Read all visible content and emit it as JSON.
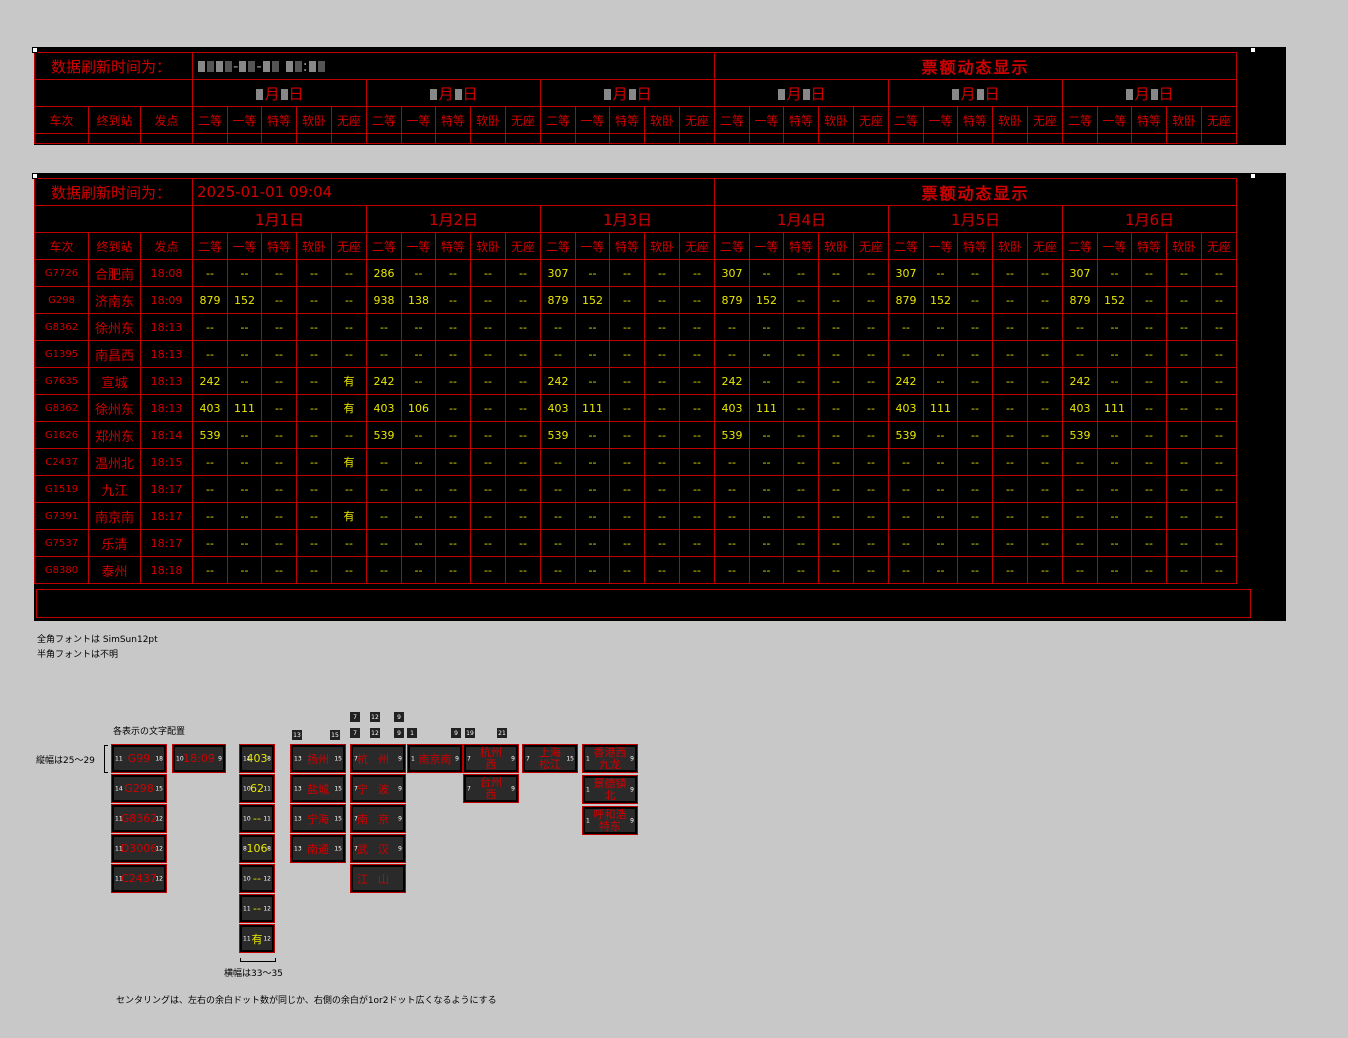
{
  "board_masked": {
    "label": "数据刷新时间为：",
    "title": "票额动态显示",
    "dates": [
      "月日",
      "月日",
      "月日",
      "月日",
      "月日",
      "月日"
    ]
  },
  "board": {
    "label": "数据刷新时间为：",
    "time": "2025-01-01 09:04",
    "title": "票额动态显示",
    "dates": [
      "1月1日",
      "1月2日",
      "1月3日",
      "1月4日",
      "1月5日",
      "1月6日"
    ],
    "col_train": "车次",
    "col_station": "终到站",
    "col_depart": "发点",
    "seat_types": [
      "二等",
      "一等",
      "特等",
      "软卧",
      "无座"
    ],
    "rows": [
      {
        "train": "G7726",
        "station": "合肥南",
        "time": "18:08",
        "cells": [
          "--",
          "--",
          "--",
          "--",
          "--",
          "286",
          "--",
          "--",
          "--",
          "--",
          "307",
          "--",
          "--",
          "--",
          "--",
          "307",
          "--",
          "--",
          "--",
          "--",
          "307",
          "--",
          "--",
          "--",
          "--",
          "307",
          "--",
          "--",
          "--",
          "--"
        ]
      },
      {
        "train": "G298",
        "station": "济南东",
        "time": "18:09",
        "cells": [
          "879",
          "152",
          "--",
          "--",
          "--",
          "938",
          "138",
          "--",
          "--",
          "--",
          "879",
          "152",
          "--",
          "--",
          "--",
          "879",
          "152",
          "--",
          "--",
          "--",
          "879",
          "152",
          "--",
          "--",
          "--",
          "879",
          "152",
          "--",
          "--",
          "--"
        ]
      },
      {
        "train": "G8362",
        "station": "徐州东",
        "time": "18:13",
        "cells": [
          "--",
          "--",
          "--",
          "--",
          "--",
          "--",
          "--",
          "--",
          "--",
          "--",
          "--",
          "--",
          "--",
          "--",
          "--",
          "--",
          "--",
          "--",
          "--",
          "--",
          "--",
          "--",
          "--",
          "--",
          "--",
          "--",
          "--",
          "--",
          "--",
          "--"
        ]
      },
      {
        "train": "G1395",
        "station": "南昌西",
        "time": "18:13",
        "cells": [
          "--",
          "--",
          "--",
          "--",
          "--",
          "--",
          "--",
          "--",
          "--",
          "--",
          "--",
          "--",
          "--",
          "--",
          "--",
          "--",
          "--",
          "--",
          "--",
          "--",
          "--",
          "--",
          "--",
          "--",
          "--",
          "--",
          "--",
          "--",
          "--",
          "--"
        ]
      },
      {
        "train": "G7635",
        "station": "宣城",
        "time": "18:13",
        "cells": [
          "242",
          "--",
          "--",
          "--",
          "有",
          "242",
          "--",
          "--",
          "--",
          "--",
          "242",
          "--",
          "--",
          "--",
          "--",
          "242",
          "--",
          "--",
          "--",
          "--",
          "242",
          "--",
          "--",
          "--",
          "--",
          "242",
          "--",
          "--",
          "--",
          "--"
        ]
      },
      {
        "train": "G8362",
        "station": "徐州东",
        "time": "18:13",
        "cells": [
          "403",
          "111",
          "--",
          "--",
          "有",
          "403",
          "106",
          "--",
          "--",
          "--",
          "403",
          "111",
          "--",
          "--",
          "--",
          "403",
          "111",
          "--",
          "--",
          "--",
          "403",
          "111",
          "--",
          "--",
          "--",
          "403",
          "111",
          "--",
          "--",
          "--"
        ]
      },
      {
        "train": "G1826",
        "station": "郑州东",
        "time": "18:14",
        "cells": [
          "539",
          "--",
          "--",
          "--",
          "--",
          "539",
          "--",
          "--",
          "--",
          "--",
          "539",
          "--",
          "--",
          "--",
          "--",
          "539",
          "--",
          "--",
          "--",
          "--",
          "539",
          "--",
          "--",
          "--",
          "--",
          "539",
          "--",
          "--",
          "--",
          "--"
        ]
      },
      {
        "train": "C2437",
        "station": "温州北",
        "time": "18:15",
        "cells": [
          "--",
          "--",
          "--",
          "--",
          "有",
          "--",
          "--",
          "--",
          "--",
          "--",
          "--",
          "--",
          "--",
          "--",
          "--",
          "--",
          "--",
          "--",
          "--",
          "--",
          "--",
          "--",
          "--",
          "--",
          "--",
          "--",
          "--",
          "--",
          "--",
          "--"
        ]
      },
      {
        "train": "G1519",
        "station": "九江",
        "time": "18:17",
        "cells": [
          "--",
          "--",
          "--",
          "--",
          "--",
          "--",
          "--",
          "--",
          "--",
          "--",
          "--",
          "--",
          "--",
          "--",
          "--",
          "--",
          "--",
          "--",
          "--",
          "--",
          "--",
          "--",
          "--",
          "--",
          "--",
          "--",
          "--",
          "--",
          "--",
          "--"
        ]
      },
      {
        "train": "G7391",
        "station": "南京南",
        "time": "18:17",
        "cells": [
          "--",
          "--",
          "--",
          "--",
          "有",
          "--",
          "--",
          "--",
          "--",
          "--",
          "--",
          "--",
          "--",
          "--",
          "--",
          "--",
          "--",
          "--",
          "--",
          "--",
          "--",
          "--",
          "--",
          "--",
          "--",
          "--",
          "--",
          "--",
          "--",
          "--"
        ]
      },
      {
        "train": "G7537",
        "station": "乐清",
        "time": "18:17",
        "cells": [
          "--",
          "--",
          "--",
          "--",
          "--",
          "--",
          "--",
          "--",
          "--",
          "--",
          "--",
          "--",
          "--",
          "--",
          "--",
          "--",
          "--",
          "--",
          "--",
          "--",
          "--",
          "--",
          "--",
          "--",
          "--",
          "--",
          "--",
          "--",
          "--",
          "--"
        ]
      },
      {
        "train": "G8380",
        "station": "泰州",
        "time": "18:18",
        "cells": [
          "--",
          "--",
          "--",
          "--",
          "--",
          "--",
          "--",
          "--",
          "--",
          "--",
          "--",
          "--",
          "--",
          "--",
          "--",
          "--",
          "--",
          "--",
          "--",
          "--",
          "--",
          "--",
          "--",
          "--",
          "--",
          "--",
          "--",
          "--",
          "--",
          "--"
        ]
      }
    ]
  },
  "notes": {
    "font_full": "全角フォントは SimSun12pt",
    "font_half": "半角フォントは不明",
    "layout_title": "各表示の文字配置",
    "height_note": "縦幅は25～29",
    "width_note": "横幅は33～35",
    "centering_note": "センタリングは、左右の余白ドット数が同じか、右側の余白が1or2ドット広くなるようにする"
  },
  "samples": {
    "trains": [
      "G99",
      "G298",
      "G8362",
      "D3006",
      "C2437"
    ],
    "time": "18:09",
    "values": [
      "403",
      "62",
      "--",
      "106",
      "--",
      "--",
      "有"
    ],
    "stations_2": [
      "扬州",
      "盐城",
      "宁海",
      "南通"
    ],
    "stations_split": [
      "杭州",
      "宁波",
      "南京",
      "武汉",
      "江山"
    ],
    "station_3": "南京南",
    "stations_stack": [
      {
        "top": "杭州",
        "bottom": "西"
      },
      {
        "top": "台州",
        "bottom": "西"
      }
    ],
    "station_shangsong": {
      "top": "上海",
      "bottom": "松江"
    },
    "stations_long": [
      {
        "top": "香港西",
        "bottom": "九龙"
      },
      {
        "top": "景德镇",
        "bottom": "北"
      },
      {
        "top": "呼和浩",
        "bottom": "特东"
      }
    ]
  }
}
